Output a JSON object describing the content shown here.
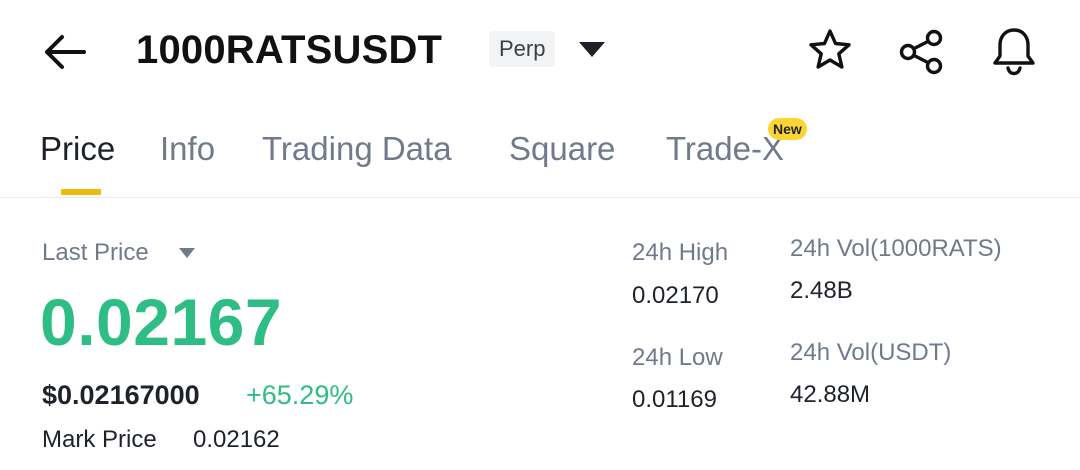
{
  "header": {
    "symbol": "1000RATSUSDT",
    "contract_type": "Perp",
    "icons": [
      "arrow-left-icon",
      "caret-down-icon",
      "star-icon",
      "share-icon",
      "bell-icon"
    ]
  },
  "tabs": [
    {
      "label": "Price",
      "active": true
    },
    {
      "label": "Info",
      "active": false
    },
    {
      "label": "Trading Data",
      "active": false
    },
    {
      "label": "Square",
      "active": false
    },
    {
      "label": "Trade-X",
      "active": false,
      "badge": "New"
    }
  ],
  "price": {
    "label": "Last Price",
    "last": "0.02167",
    "usd": "$0.02167000",
    "change_pct": "+65.29%",
    "mark_label": "Mark Price",
    "mark_value": "0.02162"
  },
  "stats": {
    "high_label": "24h High",
    "high_value": "0.02170",
    "low_label": "24h Low",
    "low_value": "0.01169",
    "vol_base_label": "24h Vol(1000RATS)",
    "vol_base_value": "2.48B",
    "vol_quote_label": "24h Vol(USDT)",
    "vol_quote_value": "42.88M"
  },
  "colors": {
    "up": "#2ebd85",
    "accent": "#f0b90b",
    "badge": "#fcd535",
    "muted": "#707a8a",
    "text": "#1e2329"
  }
}
